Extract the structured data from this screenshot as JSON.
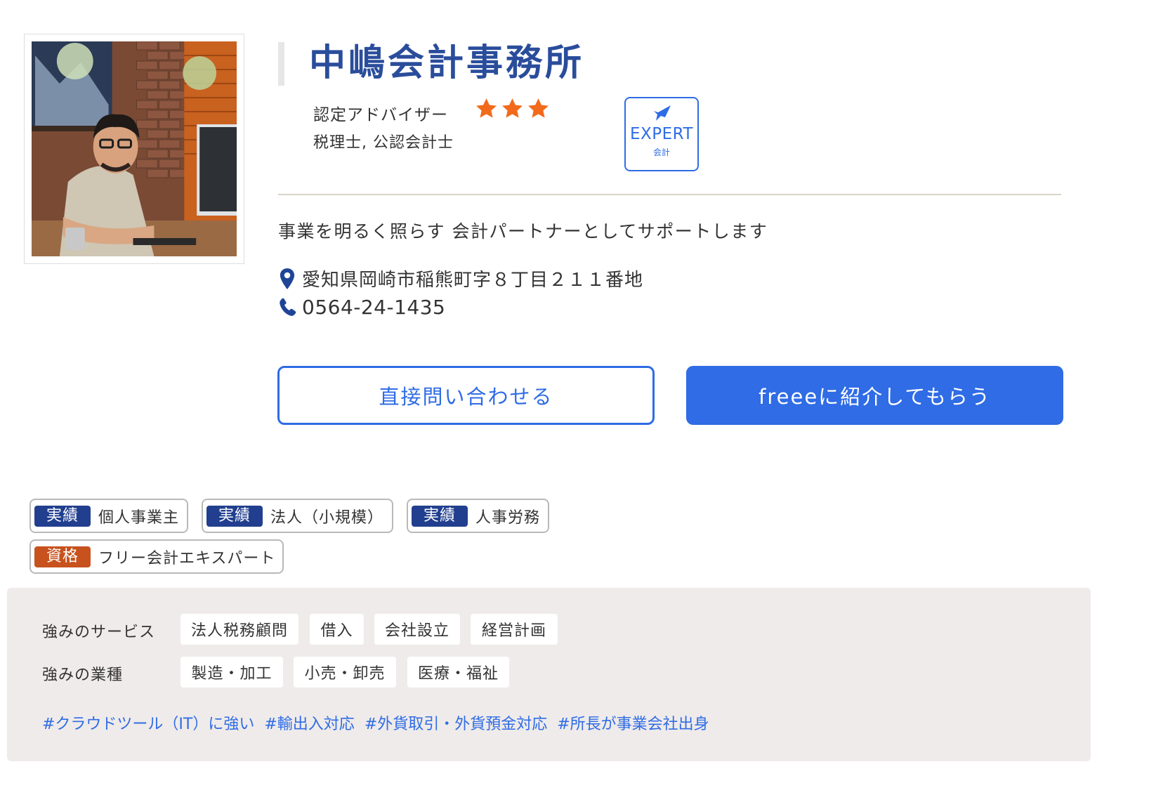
{
  "office": {
    "name": "中嶋会計事務所",
    "adviser_label": "認定アドバイザー",
    "star_rating": 3,
    "qualifications": "税理士, 公認会計士",
    "photo_alt": "事務所代表の写真"
  },
  "expert_badge": {
    "title": "EXPERT",
    "subtitle": "会計"
  },
  "tagline": "事業を明るく照らす 会計パートナーとしてサポートします",
  "contact": {
    "address": "愛知県岡崎市稲熊町字８丁目２１１番地",
    "phone": "0564-24-1435"
  },
  "buttons": {
    "direct_contact": "直接問い合わせる",
    "referral": "freeeに紹介してもらう"
  },
  "tags": [
    {
      "category": "実績",
      "label": "個人事業主"
    },
    {
      "category": "実績",
      "label": "法人（小規模）"
    },
    {
      "category": "実績",
      "label": "人事労務"
    },
    {
      "category": "資格",
      "label": "フリー会計エキスパート"
    }
  ],
  "strengths": {
    "services_label": "強みのサービス",
    "services": [
      "法人税務顧問",
      "借入",
      "会社設立",
      "経営計画"
    ],
    "industries_label": "強みの業種",
    "industries": [
      "製造・加工",
      "小売・卸売",
      "医療・福祉"
    ],
    "hashtags": [
      "#クラウドツール（IT）に強い",
      "#輸出入対応",
      "#外貨取引・外貨預金対応",
      "#所長が事業会社出身"
    ]
  },
  "colors": {
    "title_blue": "#2a4d9b",
    "accent_blue": "#2f6ce5",
    "record_tag": "#213f8e",
    "license_tag": "#c7521d",
    "star": "#f26a1b",
    "panel_bg": "#efebea"
  },
  "icons": {
    "star": "star-icon",
    "location": "map-pin-icon",
    "phone": "phone-icon",
    "expert": "bird-icon"
  }
}
